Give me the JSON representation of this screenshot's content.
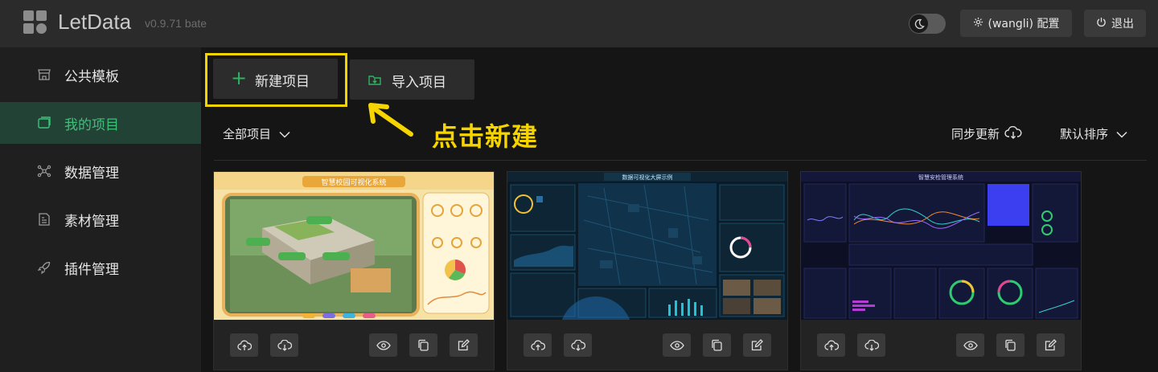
{
  "app": {
    "name": "LetData",
    "version": "v0.9.71 bate"
  },
  "header": {
    "config_label": "(wangli) 配置",
    "logout_label": "退出"
  },
  "sidebar": {
    "items": [
      {
        "label": "公共模板",
        "icon": "storefront-icon",
        "active": false
      },
      {
        "label": "我的项目",
        "icon": "layers-icon",
        "active": true
      },
      {
        "label": "数据管理",
        "icon": "network-icon",
        "active": false
      },
      {
        "label": "素材管理",
        "icon": "image-file-icon",
        "active": false
      },
      {
        "label": "插件管理",
        "icon": "rocket-icon",
        "active": false
      }
    ]
  },
  "toolbar": {
    "new_label": "新建项目",
    "import_label": "导入项目"
  },
  "annotation": {
    "text": "点击新建"
  },
  "filter": {
    "selected": "全部项目"
  },
  "sync": {
    "label": "同步更新"
  },
  "sort": {
    "selected": "默认排序"
  },
  "projects": [
    {
      "thumb_title": "智慧校园可视化系统",
      "theme": "campus"
    },
    {
      "thumb_title": "数据可视化大屏示例",
      "theme": "city"
    },
    {
      "thumb_title": "智慧安检管理系统",
      "theme": "security"
    }
  ],
  "colors": {
    "accent_green": "#3fc07a",
    "annotation_yellow": "#f5d400",
    "sidebar_active_bg": "#234236"
  }
}
